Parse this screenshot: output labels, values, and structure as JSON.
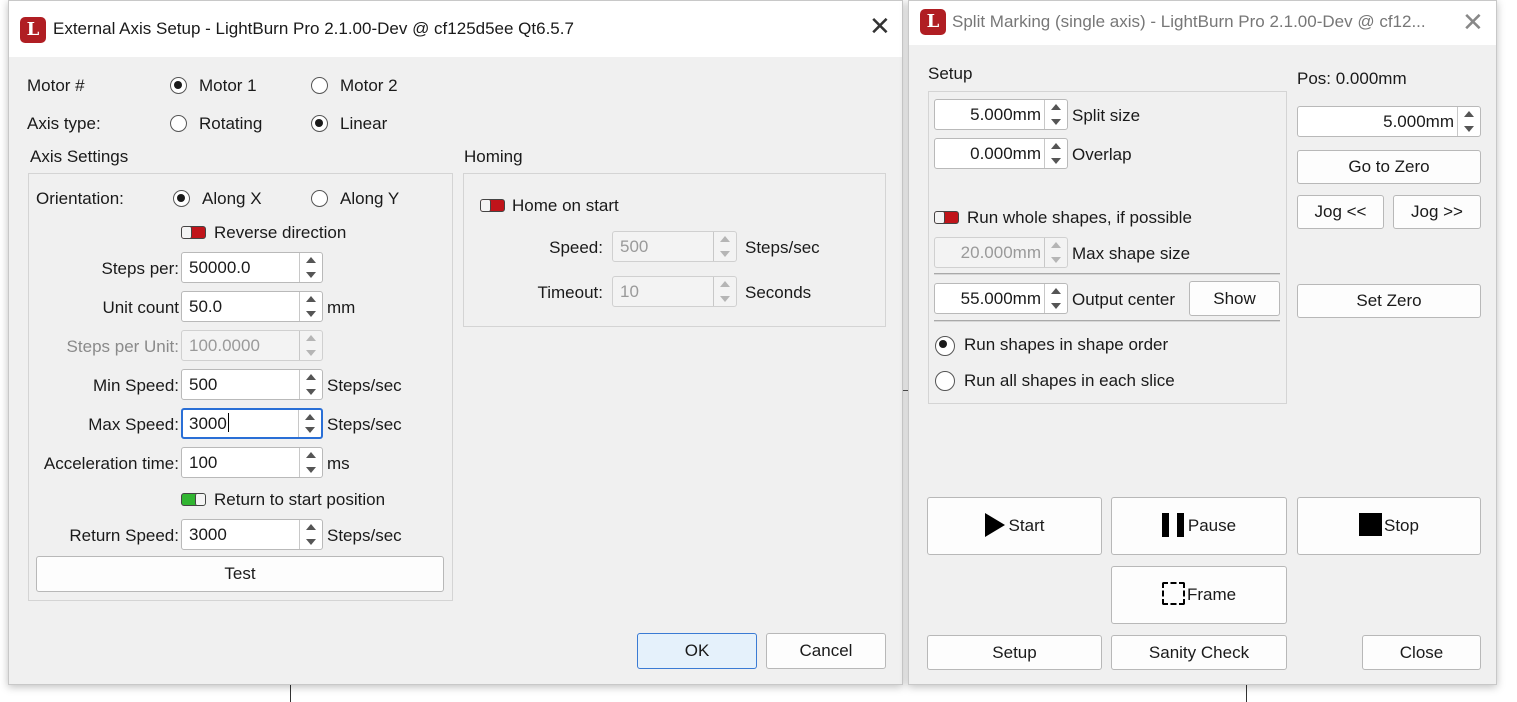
{
  "ext_dialog": {
    "title": "External Axis Setup - LightBurn Pro 2.1.00-Dev @ cf125d5ee Qt6.5.7",
    "motor_label": "Motor #",
    "motor1": "Motor 1",
    "motor2": "Motor 2",
    "axis_type_label": "Axis type:",
    "rotating": "Rotating",
    "linear": "Linear",
    "axis_settings_title": "Axis Settings",
    "orientation_label": "Orientation:",
    "along_x": "Along X",
    "along_y": "Along Y",
    "reverse_direction": "Reverse direction",
    "steps_per_label": "Steps per:",
    "steps_per_value": "50000.0",
    "unit_count_label": "Unit count",
    "unit_count_value": "50.0",
    "unit_count_unit": "mm",
    "steps_per_unit_label": "Steps per Unit:",
    "steps_per_unit_value": "100.0000",
    "min_speed_label": "Min Speed:",
    "min_speed_value": "500",
    "max_speed_label": "Max Speed:",
    "max_speed_value": "3000",
    "accel_label": "Acceleration time:",
    "accel_value": "100",
    "accel_unit": "ms",
    "steps_sec": "Steps/sec",
    "return_to_start": "Return to start position",
    "return_speed_label": "Return Speed:",
    "return_speed_value": "3000",
    "test_button": "Test",
    "homing_title": "Homing",
    "home_on_start": "Home on start",
    "homing_speed_label": "Speed:",
    "homing_speed_value": "500",
    "homing_speed_unit": "Steps/sec",
    "timeout_label": "Timeout:",
    "timeout_value": "10",
    "timeout_unit": "Seconds",
    "ok_button": "OK",
    "cancel_button": "Cancel"
  },
  "split_dialog": {
    "title": "Split Marking (single axis) - LightBurn Pro 2.1.00-Dev @ cf12...",
    "setup_title": "Setup",
    "split_size_value": "5.000mm",
    "split_size_label": "Split size",
    "overlap_value": "0.000mm",
    "overlap_label": "Overlap",
    "run_whole_shapes": "Run whole shapes, if possible",
    "max_shape_value": "20.000mm",
    "max_shape_label": "Max shape size",
    "output_center_value": "55.000mm",
    "output_center_label": "Output center",
    "show_button": "Show",
    "run_shape_order": "Run shapes in shape order",
    "run_each_slice": "Run all shapes in each slice",
    "pos_label": "Pos: 0.000mm",
    "jog_value": "5.000mm",
    "go_to_zero": "Go to Zero",
    "jog_back": "Jog <<",
    "jog_fwd": "Jog >>",
    "set_zero": "Set Zero",
    "start": "Start",
    "pause": "Pause",
    "stop": "Stop",
    "frame": "Frame",
    "setup_button": "Setup",
    "sanity_check": "Sanity Check",
    "close_button": "Close"
  },
  "icons": {
    "app": "lightburn-logo-icon",
    "close": "close-icon"
  },
  "colors": {
    "toggle_off": "#c0141a",
    "toggle_on": "#31b531",
    "focus": "#2a6fd6",
    "app_icon": "#b01e23"
  }
}
